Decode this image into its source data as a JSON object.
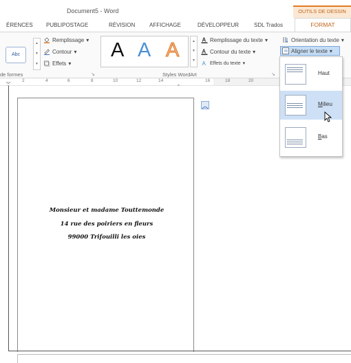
{
  "window": {
    "title": "Document5 - Word",
    "context_tab": "OUTILS DE DESSIN"
  },
  "tabs": [
    {
      "label": "ÉRENCES"
    },
    {
      "label": "PUBLIPOSTAGE"
    },
    {
      "label": "RÉVISION"
    },
    {
      "label": "AFFICHAGE"
    },
    {
      "label": "DÉVELOPPEUR"
    },
    {
      "label": "SDL Trados"
    },
    {
      "label": "FORMAT",
      "active": true
    }
  ],
  "ribbon": {
    "shape_styles": {
      "sample_label": "Abc",
      "fill": "Remplissage",
      "outline": "Contour",
      "effects": "Effets",
      "group_label": "de formes"
    },
    "wordart": {
      "letters": [
        "A",
        "A",
        "A"
      ],
      "text_fill": "Remplissage du texte",
      "text_outline": "Contour du texte",
      "text_effects": "Effets du texte",
      "group_label": "Styles WordArt"
    },
    "text": {
      "orientation": "Orientation du texte",
      "align": "Aligner le texte"
    },
    "dropdown_suffix": "▾"
  },
  "ruler": {
    "numbers": [
      "2",
      "4",
      "6",
      "8",
      "10",
      "12",
      "14",
      "16",
      "18",
      "20"
    ]
  },
  "envelope": {
    "lines": [
      "Monsieur et madame Touttemonde",
      "14 rue des poiriers en fleurs",
      "99000 Trifouilli les oies"
    ]
  },
  "align_menu": {
    "items": [
      {
        "label": "Haut",
        "underline_char": ""
      },
      {
        "label_pre": "",
        "label_u": "M",
        "label_post": "ilieu"
      },
      {
        "label_pre": "",
        "label_u": "B",
        "label_post": "as"
      }
    ]
  },
  "colors": {
    "accent": "#e07b22",
    "selection": "#cde0f5",
    "wordart_blue": "#4a90d9",
    "wordart_orange": "#f0a070"
  }
}
